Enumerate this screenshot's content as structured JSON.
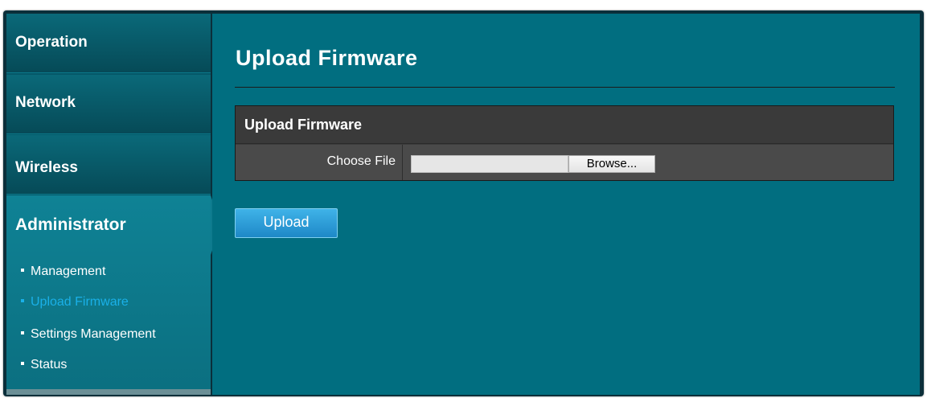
{
  "sidebar": {
    "menu": [
      {
        "label": "Operation"
      },
      {
        "label": "Network"
      },
      {
        "label": "Wireless"
      }
    ],
    "active_section": {
      "label": "Administrator"
    },
    "sub_items": [
      {
        "label": "Management",
        "active": false
      },
      {
        "label": "Upload Firmware",
        "active": true
      },
      {
        "label": "Settings Management",
        "active": false
      },
      {
        "label": "Status",
        "active": false
      }
    ]
  },
  "main": {
    "page_title": "Upload Firmware",
    "panel": {
      "header": "Upload Firmware",
      "choose_file_label": "Choose File",
      "file_value": "",
      "browse_label": "Browse..."
    },
    "upload_label": "Upload"
  },
  "colors": {
    "accent": "#1ab0e8",
    "content_bg": "#016e80",
    "panel_bg": "#3a3a3a",
    "button_blue": "#1e88c7"
  }
}
